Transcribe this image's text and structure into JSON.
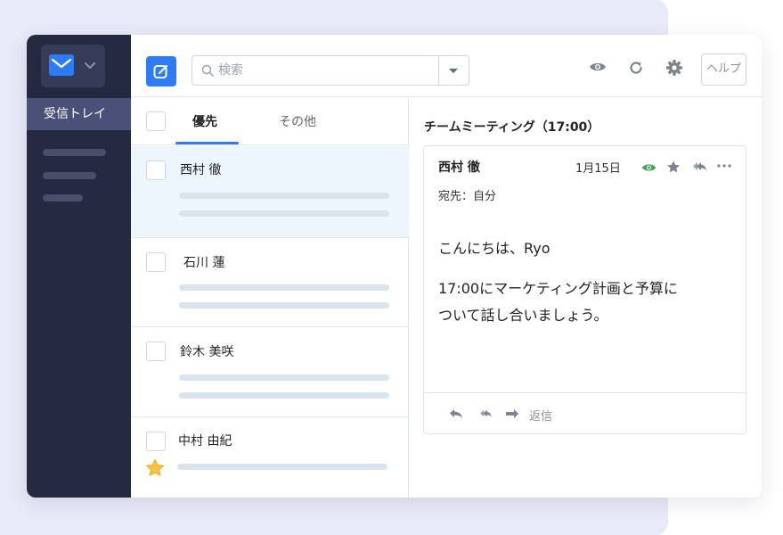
{
  "sidebar": {
    "app_icon": "mail-icon",
    "inbox_label": "受信トレイ"
  },
  "toolbar": {
    "compose_icon": "compose-icon",
    "search_placeholder": "検索",
    "help_label": "ヘルプ",
    "icons": [
      "eye-icon",
      "refresh-icon",
      "gear-icon"
    ]
  },
  "list": {
    "tabs": [
      {
        "label": "優先",
        "active": true
      },
      {
        "label": "その他",
        "active": false
      }
    ],
    "messages": [
      {
        "sender": "西村 徹",
        "selected": true,
        "starred": false
      },
      {
        "sender": "石川 蓮",
        "selected": false,
        "starred": false
      },
      {
        "sender": "鈴木 美咲",
        "selected": false,
        "starred": false
      },
      {
        "sender": "中村 由紀",
        "selected": false,
        "starred": true
      }
    ]
  },
  "reading": {
    "subject": "チームミーティング（17:00）",
    "sender": "西村 徹",
    "date": "1月15日",
    "to": "宛先：自分",
    "greeting": "こんにちは、Ryo",
    "body_line1": "17:00にマーケティング計画と予算に",
    "body_line2": "ついて話し合いましょう。",
    "reply_label": "返信"
  },
  "colors": {
    "accent": "#2d7cf6",
    "sidebar": "#262a40",
    "eye_green": "#3aa655",
    "star_yellow": "#f5c242"
  }
}
